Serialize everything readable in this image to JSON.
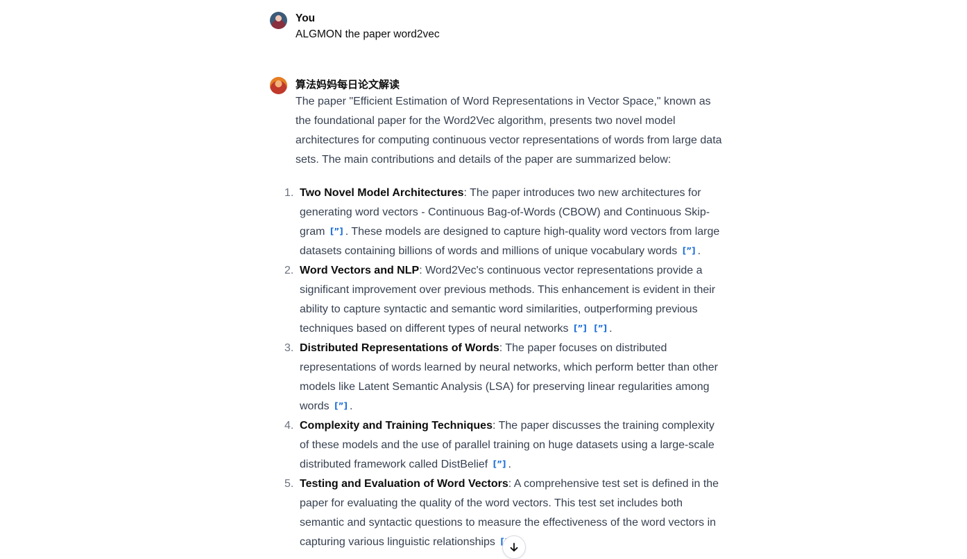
{
  "user_message": {
    "author": "You",
    "text": "ALGMON the paper word2vec"
  },
  "assistant_message": {
    "author": "算法妈妈每日论文解读",
    "intro": "The paper \"Efficient Estimation of Word Representations in Vector Space,\" known as the foundational paper for the Word2Vec algorithm, presents two novel model architectures for computing continuous vector representations of words from large data sets. The main contributions and details of the paper are summarized below:",
    "points": [
      {
        "number": "1.",
        "title": "Two Novel Model Architectures",
        "text_a": ": The paper introduces two new architectures for generating word vectors - Continuous Bag-of-Words (CBOW) and Continuous Skip-gram ",
        "text_b": ". These models are designed to capture high-quality word vectors from large datasets containing billions of words and millions of unique vocabulary words ",
        "text_c": "."
      },
      {
        "number": "2.",
        "title": "Word Vectors and NLP",
        "text_a": ": Word2Vec's continuous vector representations provide a significant improvement over previous methods. This enhancement is evident in their ability to capture syntactic and semantic word similarities, outperforming previous techniques based on different types of neural networks ",
        "text_c": "."
      },
      {
        "number": "3.",
        "title": "Distributed Representations of Words",
        "text_a": ": The paper focuses on distributed representations of words learned by neural networks, which perform better than other models like Latent Semantic Analysis (LSA) for preserving linear regularities among words ",
        "text_c": "."
      },
      {
        "number": "4.",
        "title": "Complexity and Training Techniques",
        "text_a": ": The paper discusses the training complexity of these models and the use of parallel training on huge datasets using a large-scale distributed framework called DistBelief ",
        "text_c": "."
      },
      {
        "number": "5.",
        "title": "Testing and Evaluation of Word Vectors",
        "text_a": ": A comprehensive test set is defined in the paper for evaluating the quality of the word vectors. This test set includes both semantic and syntactic questions to measure the effectiveness of the word vectors in capturing various linguistic relationships "
      }
    ],
    "citation_glyph": "[”]"
  },
  "icons": {
    "user_avatar": "user-avatar",
    "assistant_avatar": "assistant-avatar",
    "scroll_down": "arrow-down-icon"
  },
  "colors": {
    "citation": "#1d6fd9",
    "text": "#374151",
    "heading": "#0d0d0d"
  }
}
